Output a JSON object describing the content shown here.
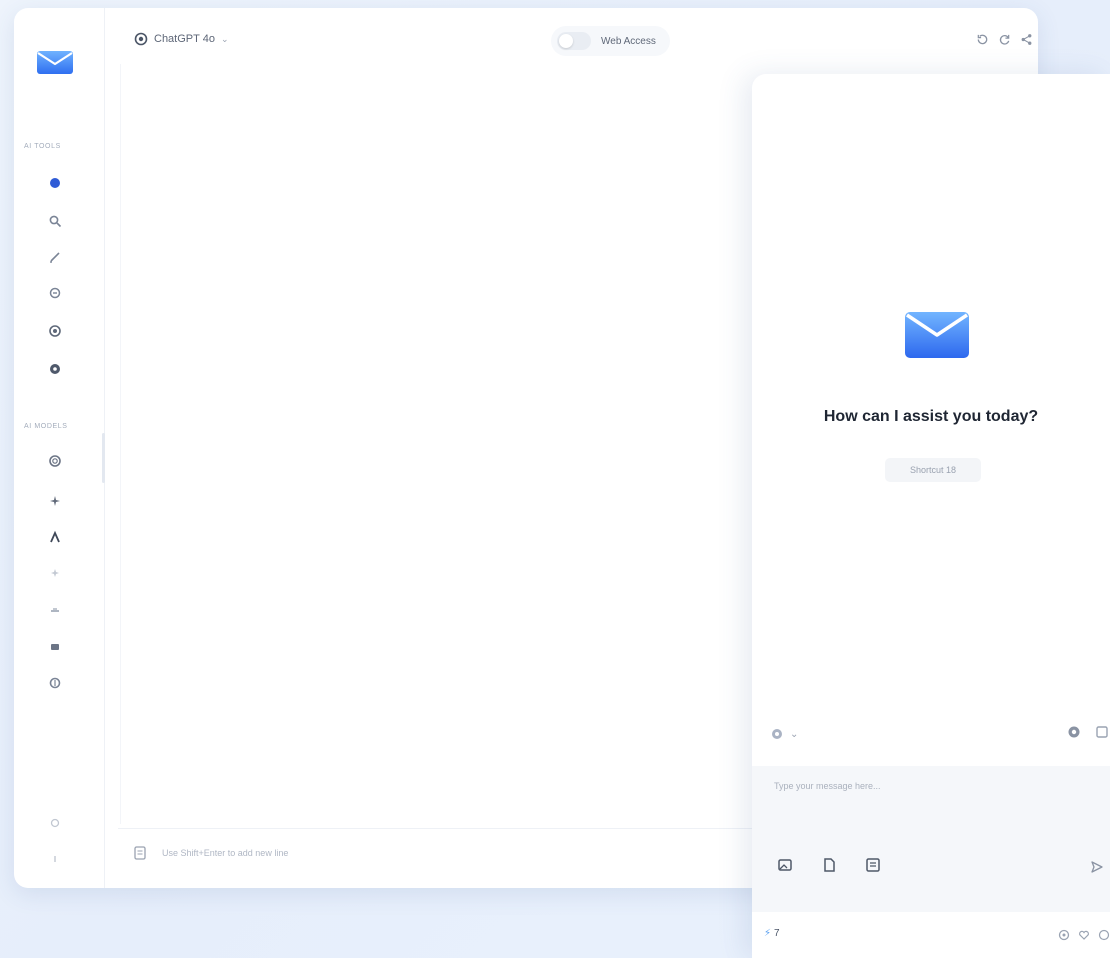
{
  "header": {
    "model_name": "ChatGPT 4o",
    "web_access_label": "Web Access"
  },
  "sidebar": {
    "section_tools": "AI TOOLS",
    "section_models": "AI MODELS"
  },
  "main": {
    "input_placeholder": "Use Shift+Enter to add new line"
  },
  "assistant": {
    "greeting": "How can I assist you today?",
    "pill_label": "Shortcut 18",
    "input_placeholder": "Type your message here...",
    "credits": "7"
  },
  "colors": {
    "accent": "#3b82f6",
    "accent_light": "#5aa0ef",
    "text_dark": "#1f2633"
  }
}
